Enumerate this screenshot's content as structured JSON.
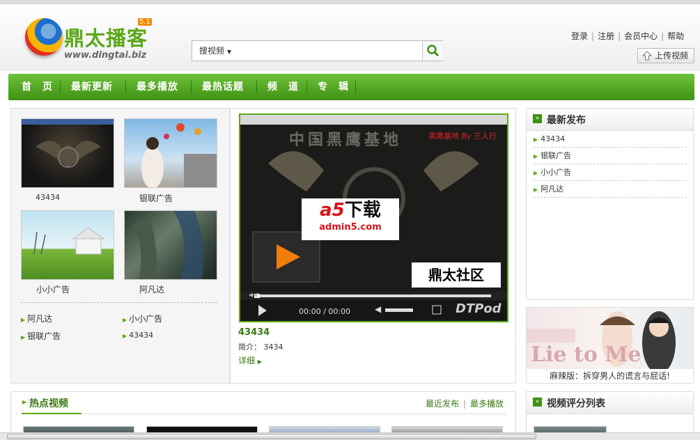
{
  "site": {
    "name_cn": "鼎太播客",
    "version": "5.1",
    "url": "www.dingtai.biz"
  },
  "search": {
    "type_label": "搜视频",
    "placeholder": ""
  },
  "toplinks": [
    "登录",
    "注册",
    "会员中心",
    "帮助"
  ],
  "upload_label": "上传视频",
  "nav": [
    "首　页",
    "最新更新",
    "最多播放",
    "最热话题",
    "频　道",
    "专　辑"
  ],
  "left_thumbs": [
    {
      "title": "43434"
    },
    {
      "title": "银联广告"
    },
    {
      "title": "小小广告"
    },
    {
      "title": "阿凡达"
    }
  ],
  "left_list": [
    "阿凡达",
    "小小广告",
    "银联广告",
    "43434"
  ],
  "player": {
    "title": "43434",
    "desc_label": "简介：",
    "desc_value": "3434",
    "more": "详细",
    "time": "00:00 / 00:00",
    "brand": "DTPod",
    "overlay_cn": "中国黑鹰基地",
    "overlay_tag": "黑鹰基地 By 三人行",
    "watermark_a5": "下载",
    "watermark_url": "admin5.com",
    "watermark_sq": "鼎太社区"
  },
  "latest": {
    "title": "最新发布",
    "items": [
      "43434",
      "银联广告",
      "小小广告",
      "阿凡达"
    ]
  },
  "ad": {
    "caption": "麻辣版：拆穿男人的谎言与屁话!",
    "slogan": "Lie to Me"
  },
  "hot": {
    "title": "热点视频",
    "links": [
      "最近发布",
      "最多播放"
    ]
  },
  "rating": {
    "title": "视频评分列表"
  },
  "colors": {
    "brand_green": "#5ca818",
    "nav_green": "#3f9214",
    "text": "#333333"
  }
}
